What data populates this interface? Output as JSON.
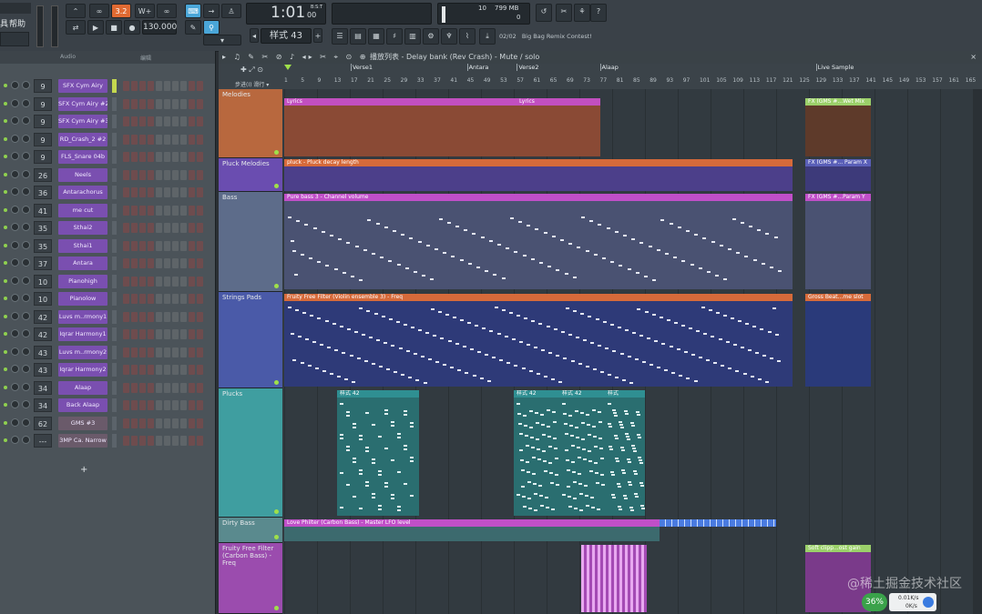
{
  "toolbar": {
    "menu_left": "帮助",
    "menu_left2": "具",
    "tempo": "130.000",
    "time": "1:01",
    "time_sub": "00",
    "bst": "B:S:T",
    "pattern": "样式 43",
    "cpu_label": "10",
    "ram_label": "799 MB",
    "ram_sub": "0",
    "hint_num": "02/02",
    "hint_text": "Big Bag Remix Contest!"
  },
  "rack": {
    "header_a": "Audio",
    "header_b": "编辑",
    "channels": [
      {
        "num": "9",
        "name": "SFX Cym Airy"
      },
      {
        "num": "9",
        "name": "SFX Cym Airy #2"
      },
      {
        "num": "9",
        "name": "SFX Cym Airy #3"
      },
      {
        "num": "9",
        "name": "RD_Crash_2 #2"
      },
      {
        "num": "9",
        "name": "FLS_Snare 04b"
      },
      {
        "num": "26",
        "name": "Neels"
      },
      {
        "num": "36",
        "name": "Antarachorus"
      },
      {
        "num": "41",
        "name": "me cut"
      },
      {
        "num": "35",
        "name": "Sthai2"
      },
      {
        "num": "35",
        "name": "Sthai1"
      },
      {
        "num": "37",
        "name": "Antara"
      },
      {
        "num": "10",
        "name": "Pianohigh"
      },
      {
        "num": "10",
        "name": "Pianolow"
      },
      {
        "num": "42",
        "name": "Luvs m..rmony1"
      },
      {
        "num": "42",
        "name": "Iqrar Harmony1"
      },
      {
        "num": "43",
        "name": "Luvs m..rmony2"
      },
      {
        "num": "43",
        "name": "Iqrar Harmony2"
      },
      {
        "num": "34",
        "name": "Alaap"
      },
      {
        "num": "34",
        "name": "Back Alaap"
      },
      {
        "num": "62",
        "name": "GMS #3"
      },
      {
        "num": "---",
        "name": "3MP Ca. Narrow"
      }
    ],
    "add": "+"
  },
  "playlist": {
    "title": "播放列表 - Delay bank (Rev Crash) - Mute / solo",
    "snap": "步进(I) 滑行 ▾",
    "ticks": [
      "1",
      "5",
      "9",
      "13",
      "17",
      "21",
      "25",
      "29",
      "33",
      "37",
      "41",
      "45",
      "49",
      "53",
      "57",
      "61",
      "65",
      "69",
      "73",
      "77",
      "81",
      "85",
      "89",
      "93",
      "97",
      "101",
      "105",
      "109",
      "113",
      "117",
      "121",
      "125",
      "129",
      "133",
      "137",
      "141",
      "145",
      "149",
      "153",
      "157",
      "161",
      "165"
    ],
    "markers": [
      {
        "label": "Verse1",
        "bar": 17
      },
      {
        "label": "Antara",
        "bar": 45
      },
      {
        "label": "Verse2",
        "bar": 57
      },
      {
        "label": "Alaap",
        "bar": 77
      },
      {
        "label": "Live Sample",
        "bar": 129
      }
    ],
    "tracks": [
      {
        "name": "Melodies",
        "color": "#b8683e"
      },
      {
        "name": "Pluck Melodies",
        "color": "#6a4db0"
      },
      {
        "name": "Bass",
        "color": "#5d6c8a"
      },
      {
        "name": "Strings Pads",
        "color": "#4a5aa8"
      },
      {
        "name": "Plucks",
        "color": "#3f9ea0"
      },
      {
        "name": "Dirty Bass",
        "color": "#5a8a8e"
      },
      {
        "name": "Fruity Free Filter (Carbon Bass) - Freq",
        "color": "#9b4cae"
      }
    ],
    "clips": {
      "lyrics1": "Lyrics",
      "lyrics2": "Lyrics",
      "fx_wet": "FX (GMS #...Wet Mix",
      "pluck": "pluck - Pluck decay length",
      "fx_param_x": "FX (GMS #... Param X",
      "pure_bass": "Pure bass 3 - Channel volume",
      "fx_param_y": "FX (GMS #...Param Y",
      "free_filter": "Fruity Free Filter (Violin ensemble 3) - Freq",
      "gross_beat": "Gross Beat...me slot",
      "pluck_pat1": "样式 42",
      "pluck_pat2": "样式 42",
      "pluck_pat3": "样式 42",
      "pluck_pat4": "样式",
      "love_philter": "Love Philter (Carbon Bass) - Master LFO level",
      "soft_clip": "Soft clipp...ost gain"
    }
  },
  "status": {
    "cpu": "36%",
    "net_up": "0.01K/s",
    "net_down": "0K/s"
  },
  "watermark": "@稀土掘金技术社区",
  "colors": {
    "accent": "#ff7a2e",
    "purple": "#b24fd0",
    "teal": "#3fa6a8"
  }
}
